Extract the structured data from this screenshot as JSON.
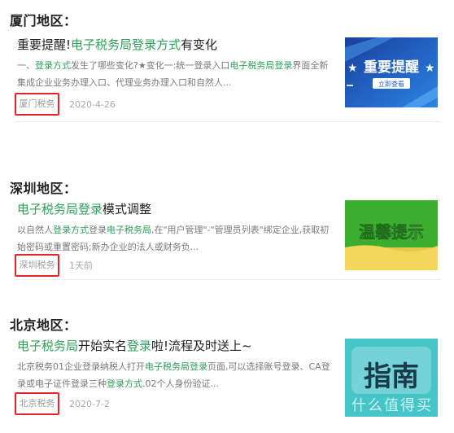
{
  "regions": [
    {
      "title": "厦门地区：",
      "article": {
        "title_parts": [
          {
            "text": "重要提醒!",
            "hl": false
          },
          {
            "text": "电子税务局登录方式",
            "hl": true
          },
          {
            "text": "有变化",
            "hl": false
          }
        ],
        "desc_parts": [
          {
            "text": "一、",
            "hl": false
          },
          {
            "text": "登录方式",
            "hl": true
          },
          {
            "text": "发生了哪些变化?★变化一:统一登录入口",
            "hl": false
          },
          {
            "text": "电子税务局登录",
            "hl": true
          },
          {
            "text": "界面全新集成企业业务办理入口、代理业务办理入口和自然人...",
            "hl": false
          }
        ],
        "tag": "厦门税务",
        "date": "2020-4-26",
        "thumb": {
          "main": "重要提醒",
          "sub": "立即查看",
          "stars": "★"
        }
      }
    },
    {
      "title": "深圳地区：",
      "article": {
        "title_parts": [
          {
            "text": "电子税务局登录",
            "hl": true
          },
          {
            "text": "模式调整",
            "hl": false
          }
        ],
        "desc_parts": [
          {
            "text": "以自然人",
            "hl": false
          },
          {
            "text": "登录方式",
            "hl": true
          },
          {
            "text": "登录",
            "hl": false
          },
          {
            "text": "电子税务局",
            "hl": true
          },
          {
            "text": ",在\"用户管理\"-\"管理员列表\"绑定企业,获取初始密码或重置密码;新办企业的法人或财务负...",
            "hl": false
          }
        ],
        "tag": "深圳税务",
        "date": "1天前",
        "thumb": {
          "main": "温馨提示"
        }
      }
    },
    {
      "title": "北京地区：",
      "article": {
        "title_parts": [
          {
            "text": "电子税务局",
            "hl": true
          },
          {
            "text": "开始实名",
            "hl": false
          },
          {
            "text": "登录",
            "hl": true
          },
          {
            "text": "啦!流程及时送上~",
            "hl": false
          }
        ],
        "desc_parts": [
          {
            "text": "北京税务01企业登录纳税人打开",
            "hl": false
          },
          {
            "text": "电子税务局登录",
            "hl": true
          },
          {
            "text": "页面,可以选择账号登录、CA登录或电子证件登录三种",
            "hl": false
          },
          {
            "text": "登录方式",
            "hl": true
          },
          {
            "text": ".02个人身份验证...",
            "hl": false
          }
        ],
        "tag": "北京税务",
        "date": "2020-7-2",
        "thumb": {
          "main": "指南",
          "watermark": "什么值得买"
        }
      }
    }
  ],
  "colors": {
    "highlight": "#2fa158",
    "tag_border": "#e02828",
    "thumb1_bg": "#1d5fc3",
    "thumb2_bg": "#3cae2f",
    "thumb3_bg": "#46c5c8"
  }
}
